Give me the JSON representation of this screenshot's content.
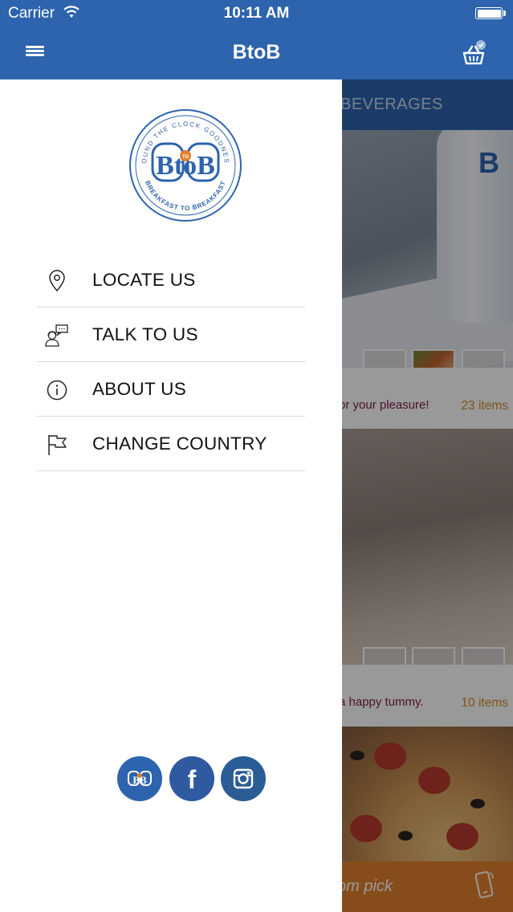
{
  "status_bar": {
    "carrier": "Carrier",
    "time": "10:11 AM"
  },
  "nav_bar": {
    "title": "BtoB"
  },
  "background": {
    "tab_label": "BEVERAGES",
    "sections": [
      {
        "tagline": "or your pleasure!",
        "count": "23 items"
      },
      {
        "tagline": "a happy tummy.",
        "count": "10 items"
      }
    ],
    "bottom_label": "om pick"
  },
  "drawer": {
    "logo": {
      "top_arc": "ROUND THE CLOCK GOODNESS",
      "center": "BtoB",
      "bottom_arc": "BREAKFAST TO BREAKFAST",
      "center_badge": "TO"
    },
    "menu_items": [
      {
        "label": "LOCATE US",
        "icon": "location-pin-icon"
      },
      {
        "label": "TALK TO US",
        "icon": "support-agent-icon"
      },
      {
        "label": "ABOUT US",
        "icon": "info-icon"
      },
      {
        "label": "CHANGE COUNTRY",
        "icon": "flag-icon"
      }
    ],
    "social": [
      {
        "name": "btob",
        "icon": "btob-logo-icon"
      },
      {
        "name": "facebook",
        "icon": "facebook-icon",
        "glyph": "f"
      },
      {
        "name": "instagram",
        "icon": "instagram-icon"
      }
    ]
  },
  "colors": {
    "primary": "#2d64ad",
    "accent_orange": "#e0812d",
    "tagline": "#7a1f4a",
    "count": "#d98b2b"
  }
}
